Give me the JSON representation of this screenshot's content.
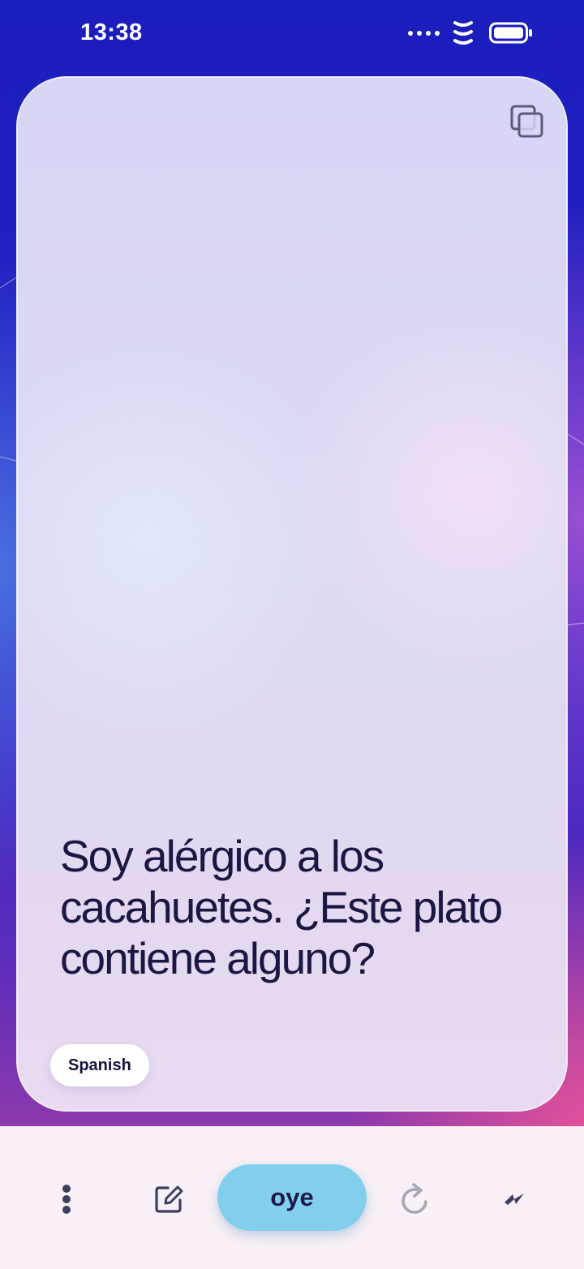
{
  "status_bar": {
    "time": "13:38"
  },
  "card": {
    "text": "Soy alérgico a los cacahuetes. ¿Este plato contiene alguno?",
    "language": "Spanish",
    "copy_icon": "copy-icon"
  },
  "bottom_bar": {
    "primary_label": "oye",
    "icons": [
      "more-vertical-icon",
      "edit-icon",
      "refresh-icon",
      "lightning-icon"
    ]
  },
  "colors": {
    "background_top": "#1a1ebc",
    "background_bottom": "#b4449e",
    "card_text": "#1a1742",
    "primary_button": "#82cfed",
    "bottom_bar": "#f8f0f6"
  }
}
